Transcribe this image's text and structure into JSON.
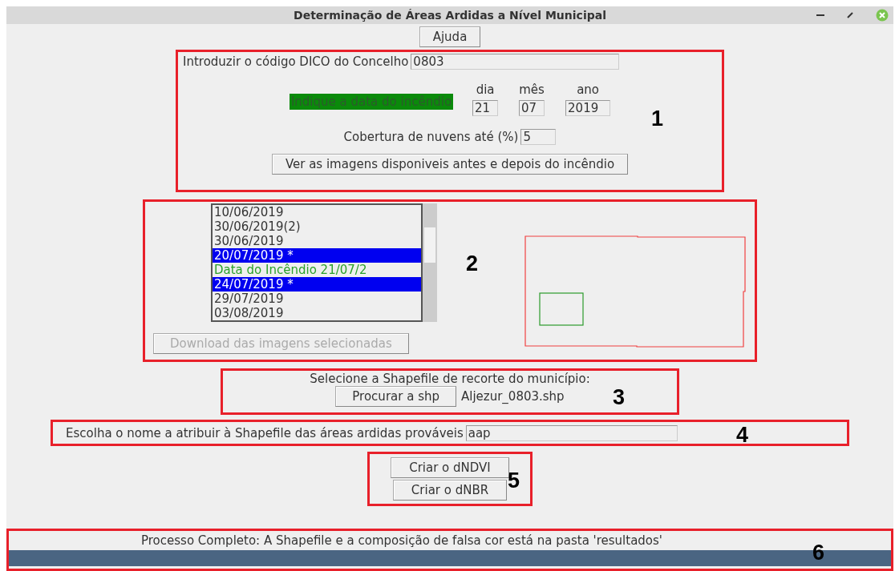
{
  "window": {
    "title": "Determinação de Áreas Ardidas a Nível Municipal"
  },
  "help_button": "Ajuda",
  "section_1": {
    "number": "1",
    "dico": {
      "label": "Introduzir o código DICO do Concelho",
      "value": "0803"
    },
    "date_prompt": "Indique a data do incêndio",
    "date_fields": [
      {
        "label": "dia",
        "value": "21"
      },
      {
        "label": "mês",
        "value": "07"
      },
      {
        "label": "ano",
        "value": "2019"
      }
    ],
    "clouds": {
      "label": "Cobertura de nuvens até (%)",
      "value": "5"
    },
    "view_button": "Ver as imagens disponiveis antes e depois do incêndio"
  },
  "section_2": {
    "number": "2",
    "images": [
      {
        "label": "10/06/2019",
        "selected": false,
        "kind": "image"
      },
      {
        "label": "30/06/2019(2)",
        "selected": false,
        "kind": "image"
      },
      {
        "label": "30/06/2019",
        "selected": false,
        "kind": "image"
      },
      {
        "label": "20/07/2019 *",
        "selected": true,
        "kind": "image"
      },
      {
        "label": "Data do Incêndio 21/07/2",
        "selected": false,
        "kind": "fire"
      },
      {
        "label": "24/07/2019 *",
        "selected": true,
        "kind": "image"
      },
      {
        "label": "29/07/2019",
        "selected": false,
        "kind": "image"
      },
      {
        "label": "03/08/2019",
        "selected": false,
        "kind": "image"
      }
    ],
    "download_button": {
      "label": "Download das imagens selecionadas",
      "disabled": true
    }
  },
  "section_3": {
    "number": "3",
    "label": "Selecione a Shapefile de recorte do município:",
    "browse_button": "Procurar a shp",
    "file": "Aljezur_0803.shp"
  },
  "section_4": {
    "number": "4",
    "label": "Escolha o nome a atribuir à Shapefile das áreas ardidas prováveis",
    "value": "aap"
  },
  "section_5": {
    "number": "5",
    "buttons": [
      "Criar o dNDVI",
      "Criar o dNBR"
    ]
  },
  "section_6": {
    "number": "6",
    "status": "Processo Completo: A Shapefile e a composição de falsa cor está na pasta 'resultados'",
    "progress": {
      "level": 1
    }
  }
}
